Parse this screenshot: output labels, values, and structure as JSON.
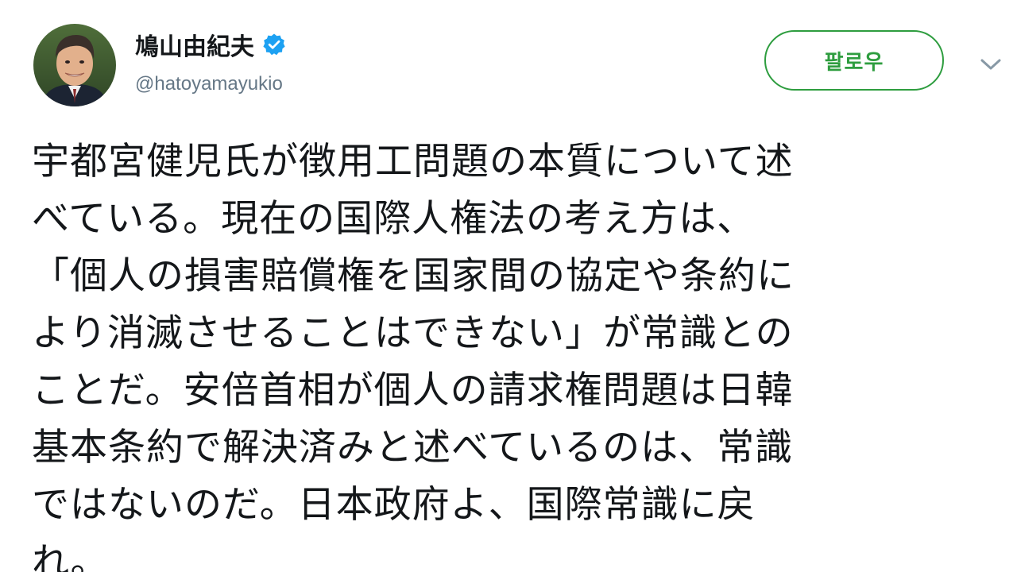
{
  "user": {
    "display_name": "鳩山由紀夫",
    "handle": "@hatoyamayukio",
    "verified": true,
    "avatar_icon": "profile-photo"
  },
  "actions": {
    "follow_label": "팔로우",
    "more_icon": "chevron-down-icon"
  },
  "tweet": {
    "lines": [
      "宇都宮健児氏が徴用工問題の本質について述",
      "べている。現在の国際人権法の考え方は、",
      "「個人の損害賠償権を国家間の協定や条約に",
      "より消滅させることはできない」が常識との",
      "ことだ。安倍首相が個人の請求権問題は日韓",
      "基本条約で解決済みと述べているのは、常識",
      "ではないのだ。日本政府よ、国際常識に戻",
      "れ。"
    ]
  },
  "colors": {
    "follow_accent": "#2e9d3f",
    "verified_badge": "#1da1f2",
    "handle_text": "#657786",
    "body_text": "#14171a"
  }
}
